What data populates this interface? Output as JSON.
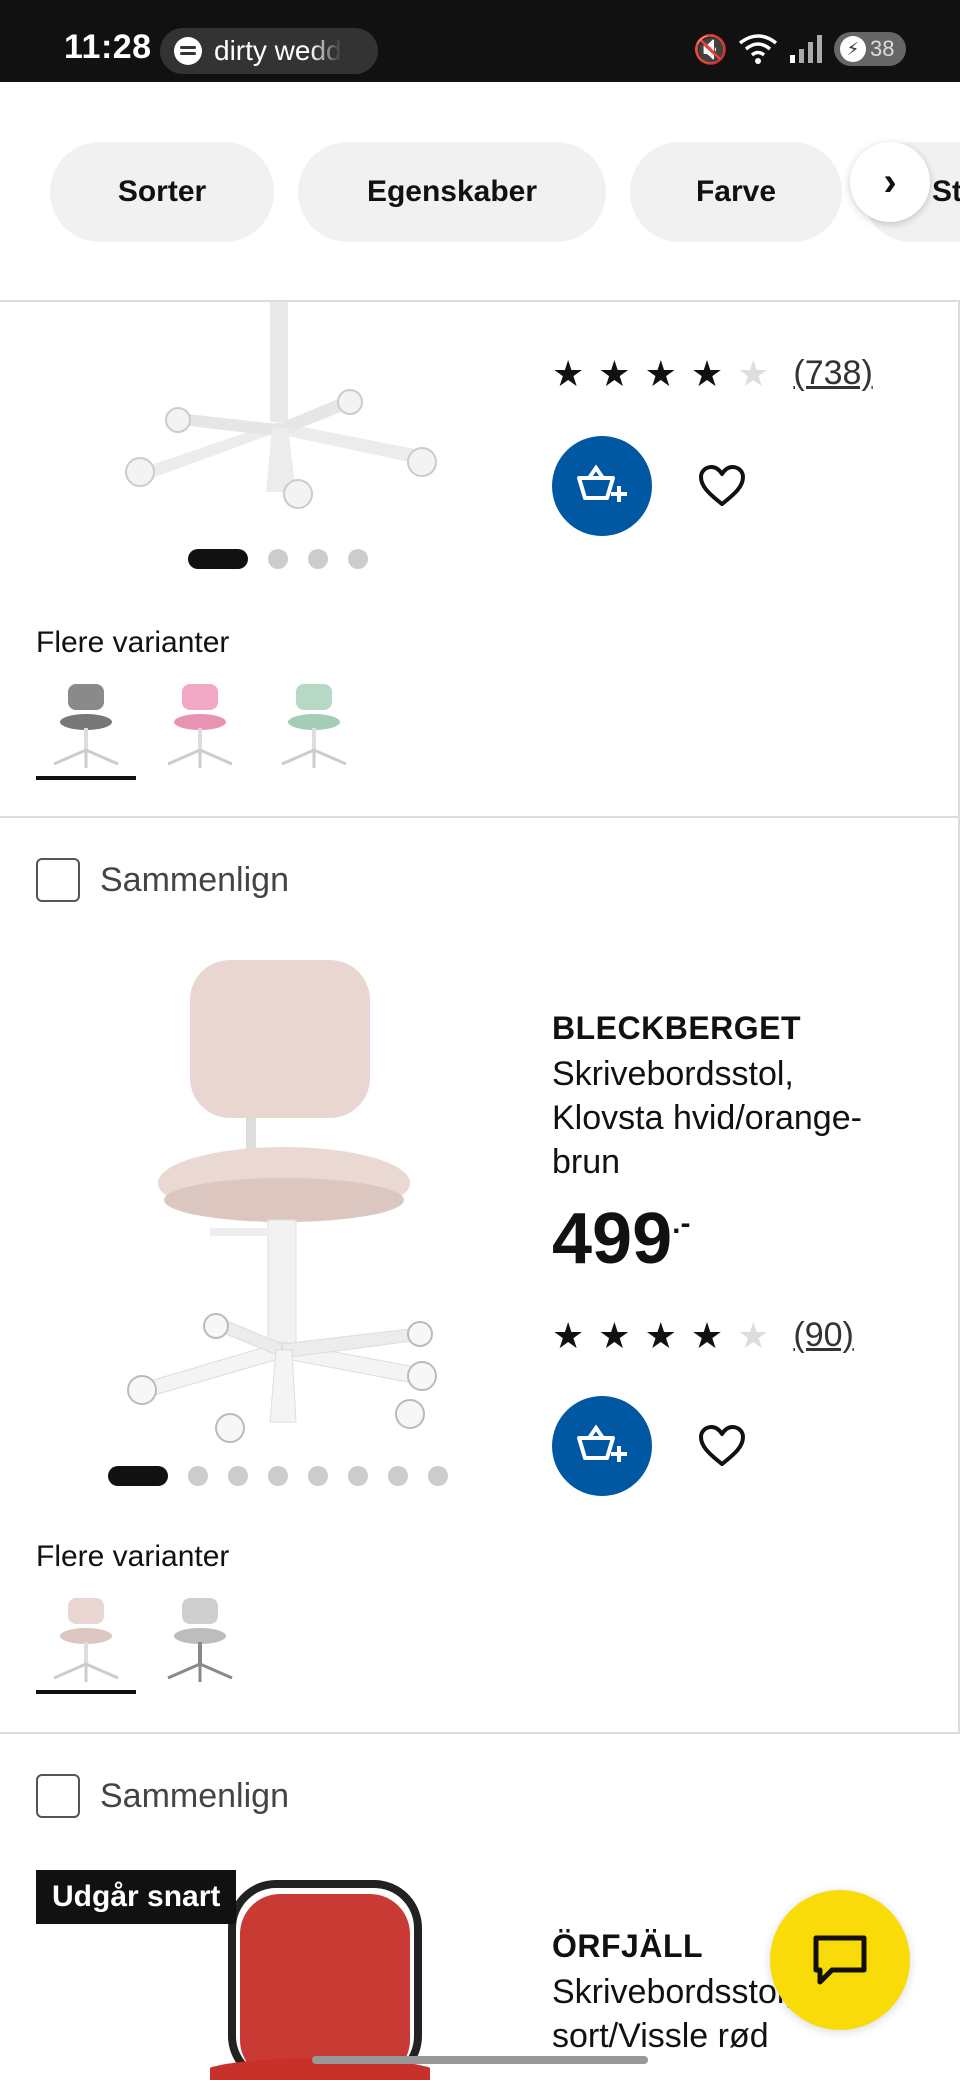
{
  "status_bar": {
    "time": "11:28",
    "media_title": "dirty wedd",
    "battery": "38",
    "network_badge": "6"
  },
  "filters": {
    "chips": [
      "Sorter",
      "Egenskaber",
      "Farve",
      "St"
    ]
  },
  "product1": {
    "rating": 4,
    "reviews": "(738)",
    "image_dots": 4,
    "variants_label": "Flere varianter",
    "variants": [
      "grey",
      "pink",
      "green"
    ]
  },
  "product2": {
    "compare_label": "Sammenlign",
    "name": "BLECKBERGET",
    "description": "Skrivebordsstol, Klovsta hvid/orange-brun",
    "price": "499",
    "price_suffix": ".-",
    "rating": 4,
    "reviews": "(90)",
    "image_dots": 8,
    "variants_label": "Flere varianter",
    "variants": [
      "beige",
      "grey"
    ]
  },
  "product3": {
    "compare_label": "Sammenlign",
    "badge": "Udgår snart",
    "name": "ÖRFJÄLL",
    "description": "Skrivebordsstol, sort/Vissle rød"
  },
  "colors": {
    "accent_blue": "#0058a3",
    "chat_yellow": "#fadb0a"
  }
}
